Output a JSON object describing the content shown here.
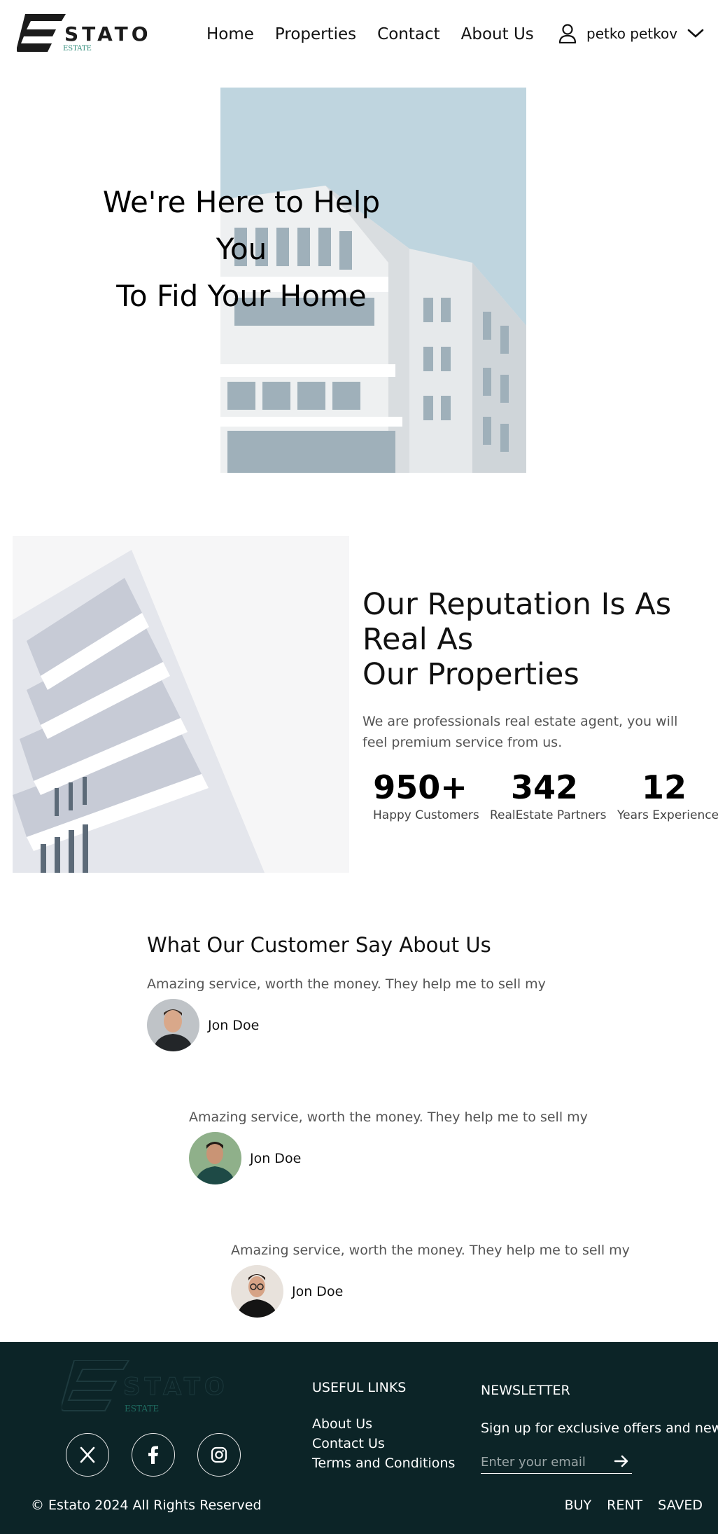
{
  "header": {
    "logo_text": "STATO",
    "logo_sub": "ESTATE",
    "nav": [
      "Home",
      "Properties",
      "Contact",
      "About Us"
    ],
    "user_name": "petko petkov"
  },
  "hero": {
    "line1": "We're Here to Help You",
    "line2": "To Fid Your Home"
  },
  "reputation": {
    "title_line1": "Our Reputation Is As Real As",
    "title_line2": "Our Properties",
    "description": "We are professionals real estate agent, you will feel premium service from us.",
    "stats": [
      {
        "value": "950+",
        "label": "Happy Customers"
      },
      {
        "value": "342",
        "label": "RealEstate Partners"
      },
      {
        "value": "12",
        "label": "Years Experience"
      }
    ]
  },
  "testimonials": {
    "title": "What Our Customer Say About Us",
    "items": [
      {
        "quote": "Amazing service, worth the money. They help me to sell my",
        "name": "Jon Doe"
      },
      {
        "quote": "Amazing service, worth the money. They help me to sell my",
        "name": "Jon Doe"
      },
      {
        "quote": "Amazing service, worth the money. They help me to sell my",
        "name": "Jon Doe"
      }
    ]
  },
  "footer": {
    "logo_text": "STATO",
    "logo_sub": "ESTATE",
    "useful_links_title": "USEFUL LINKS",
    "links": [
      "About Us",
      "Contact Us",
      "Terms and Conditions"
    ],
    "newsletter_title": "NEWSLETTER",
    "newsletter_text": "Sign up for exclusive offers and news",
    "email_placeholder": "Enter your email",
    "copyright": "© Estato 2024 All Rights Reserved",
    "bottom_links": [
      "BUY",
      "RENT",
      "SAVED"
    ]
  },
  "colors": {
    "footer_bg": "#0c2427",
    "accent": "#2e8b7a"
  }
}
